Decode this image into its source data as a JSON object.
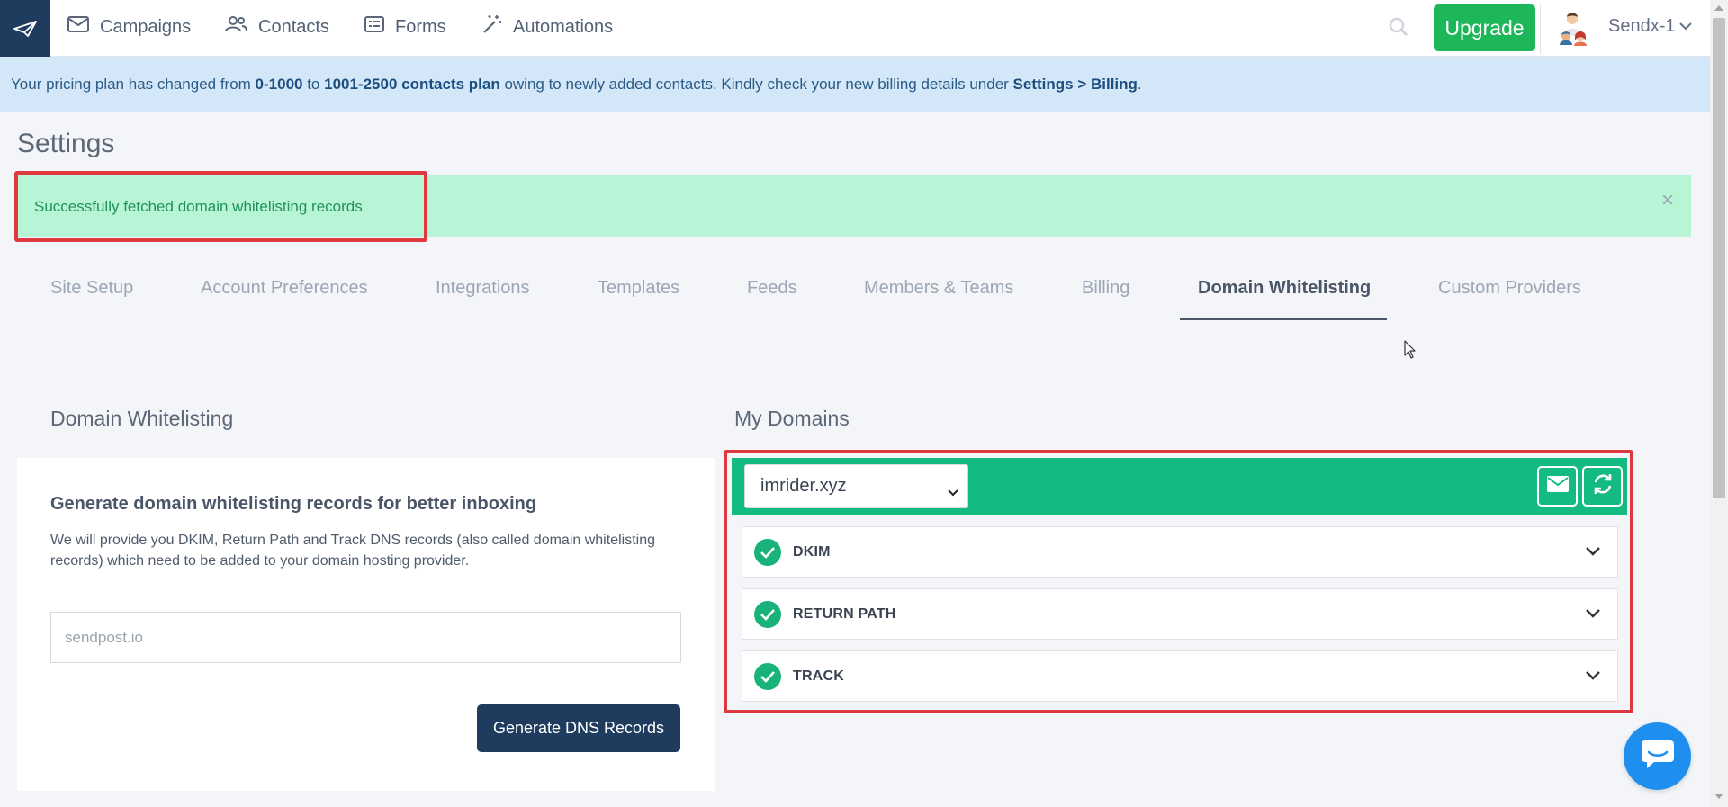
{
  "nav": {
    "items": [
      {
        "label": "Campaigns",
        "icon": "mail-icon"
      },
      {
        "label": "Contacts",
        "icon": "users-icon"
      },
      {
        "label": "Forms",
        "icon": "form-icon"
      },
      {
        "label": "Automations",
        "icon": "magic-wand-icon"
      }
    ],
    "upgrade_label": "Upgrade",
    "account_name": "Sendx-1"
  },
  "banner": {
    "prefix": "Your pricing plan has changed from ",
    "from_plan": "0-1000",
    "to_text": " to ",
    "to_plan": "1001-2500 contacts plan",
    "middle": " owing to newly added contacts. Kindly check your new billing details under ",
    "link": "Settings > Billing",
    "suffix": "."
  },
  "page": {
    "title": "Settings"
  },
  "alert": {
    "message": "Successfully fetched domain whitelisting records",
    "close": "×"
  },
  "tabs": [
    {
      "label": "Site Setup",
      "active": false
    },
    {
      "label": "Account Preferences",
      "active": false
    },
    {
      "label": "Integrations",
      "active": false
    },
    {
      "label": "Templates",
      "active": false
    },
    {
      "label": "Feeds",
      "active": false
    },
    {
      "label": "Members & Teams",
      "active": false
    },
    {
      "label": "Billing",
      "active": false
    },
    {
      "label": "Domain Whitelisting",
      "active": true
    },
    {
      "label": "Custom Providers",
      "active": false
    }
  ],
  "left": {
    "section_title": "Domain Whitelisting",
    "heading": "Generate domain whitelisting records for better inboxing",
    "description": "We will provide you DKIM, Return Path and Track DNS records (also called domain whitelisting records) which need to be added to your domain hosting provider.",
    "input_placeholder": "sendpost.io",
    "generate_label": "Generate DNS Records"
  },
  "right": {
    "section_title": "My Domains",
    "selected_domain": "imrider.xyz",
    "records": [
      {
        "label": "DKIM",
        "status": "verified"
      },
      {
        "label": "RETURN PATH",
        "status": "verified"
      },
      {
        "label": "TRACK",
        "status": "verified"
      }
    ]
  },
  "colors": {
    "brand_navy": "#1f3b5e",
    "upgrade_green": "#1db75a",
    "domain_header_green": "#13bb80",
    "alert_bg": "#b8f5d6",
    "highlight_red": "#e0383f",
    "chat_blue": "#1e8fef"
  }
}
